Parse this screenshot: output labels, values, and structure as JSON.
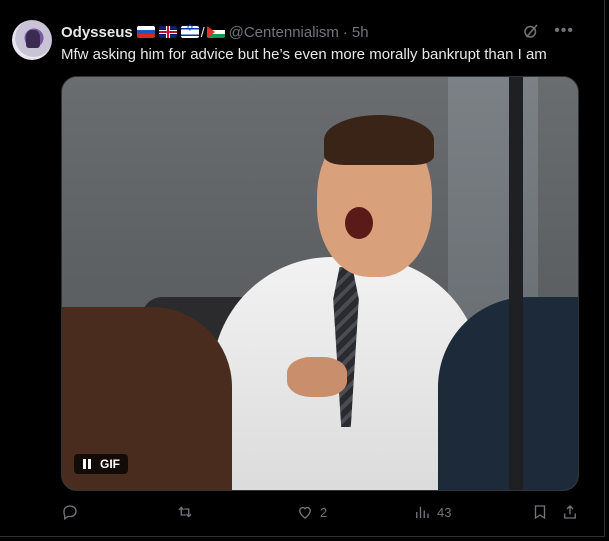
{
  "tweet": {
    "display_name": "Odysseus",
    "flags": [
      "ru-flag-icon",
      "uk-flag-icon",
      "il-flag-icon",
      "ps-flag-icon"
    ],
    "flag_separator": "/",
    "handle": "@Centennialism",
    "separator": "·",
    "time": "5h",
    "text": "Mfw asking him for advice but he’s even more morally bankrupt than I am",
    "media": {
      "type": "gif",
      "badge_label": "GIF"
    },
    "stats": {
      "likes": "2",
      "views": "43"
    }
  },
  "colors": {
    "background": "#000000",
    "text": "#e7e9ea",
    "muted": "#71767b",
    "border": "#2f3336"
  }
}
